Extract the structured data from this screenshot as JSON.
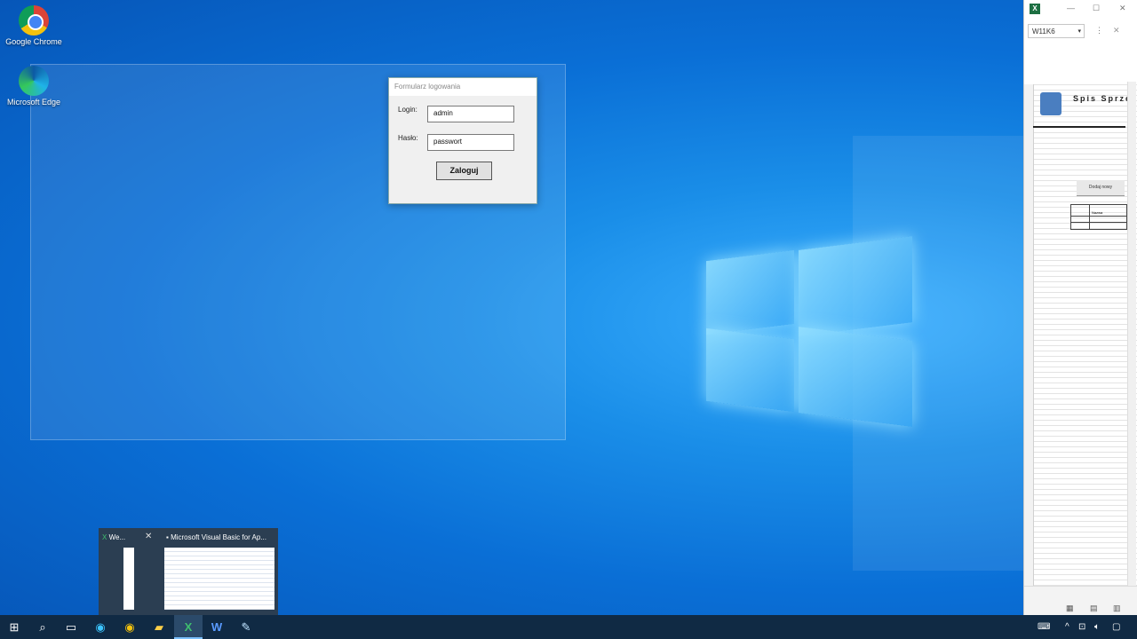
{
  "desktop": {
    "icons": [
      {
        "label": "Google Chrome"
      },
      {
        "label": "Microsoft Edge"
      }
    ]
  },
  "dialog": {
    "title": "Formularz logowania",
    "login_label": "Login:",
    "login_value": "admin",
    "password_label": "Hasło:",
    "password_value": "passwort",
    "submit_label": "Zaloguj"
  },
  "excel": {
    "name_box": "W11K6",
    "sheet_title": "Spis Sprzę",
    "add_button": "Dodaj nowy",
    "table_header": "Nazwa"
  },
  "flyout": {
    "items": [
      {
        "label": "We..."
      },
      {
        "label": "Microsoft Visual Basic for Ap..."
      }
    ]
  },
  "colors": {
    "taskbar": "#102a44",
    "excel_green": "#1d6f42"
  }
}
